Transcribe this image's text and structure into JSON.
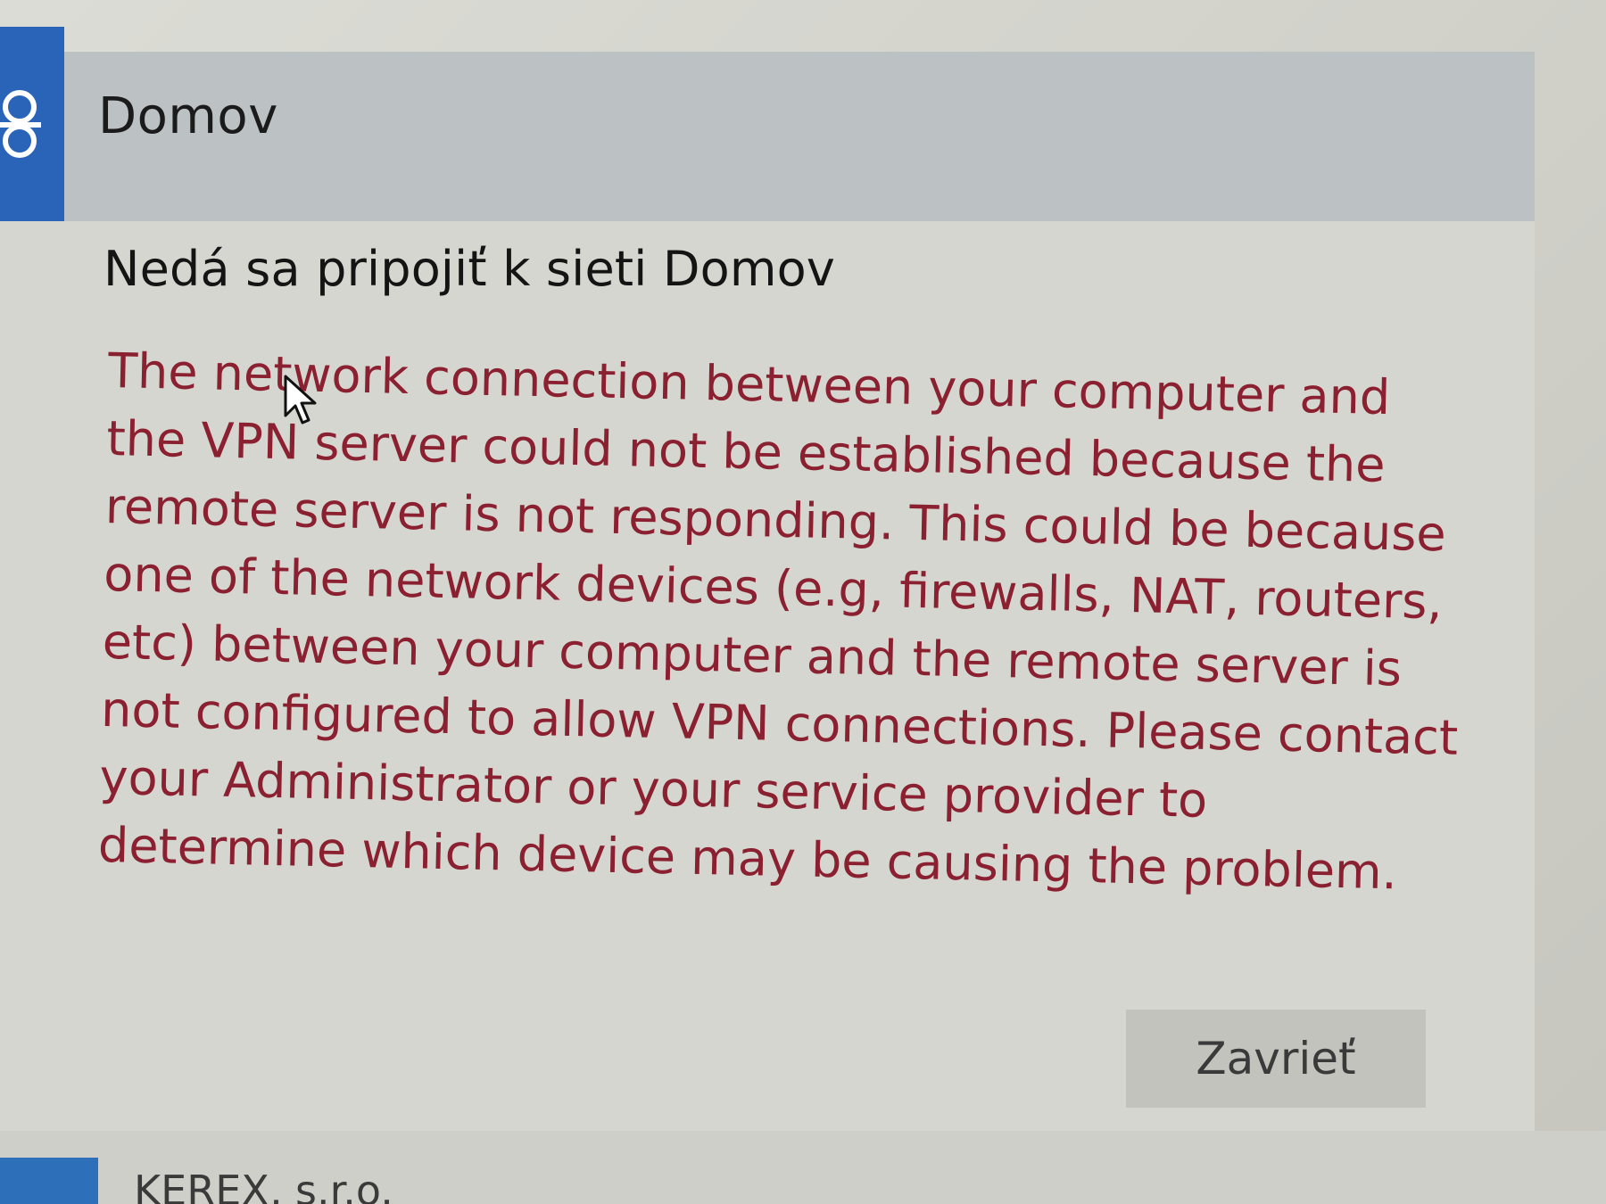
{
  "network": {
    "name": "Domov",
    "icon": "vpn-icon"
  },
  "dialog": {
    "title": "Nedá sa pripojiť k sieti Domov",
    "message": "The network connection between your computer and the VPN server could not be established because the remote server is not responding. This could be because one of the network devices (e.g, firewalls, NAT, routers, etc) between your computer and the remote server is not configured to allow VPN connections. Please contact your Administrator or your service provider to determine which device may be causing the problem.",
    "close_label": "Zavrieť"
  },
  "next_item": {
    "label": "KEREX, s.r.o."
  },
  "colors": {
    "accent": "#2a64b8",
    "error_text": "#8a2030"
  }
}
